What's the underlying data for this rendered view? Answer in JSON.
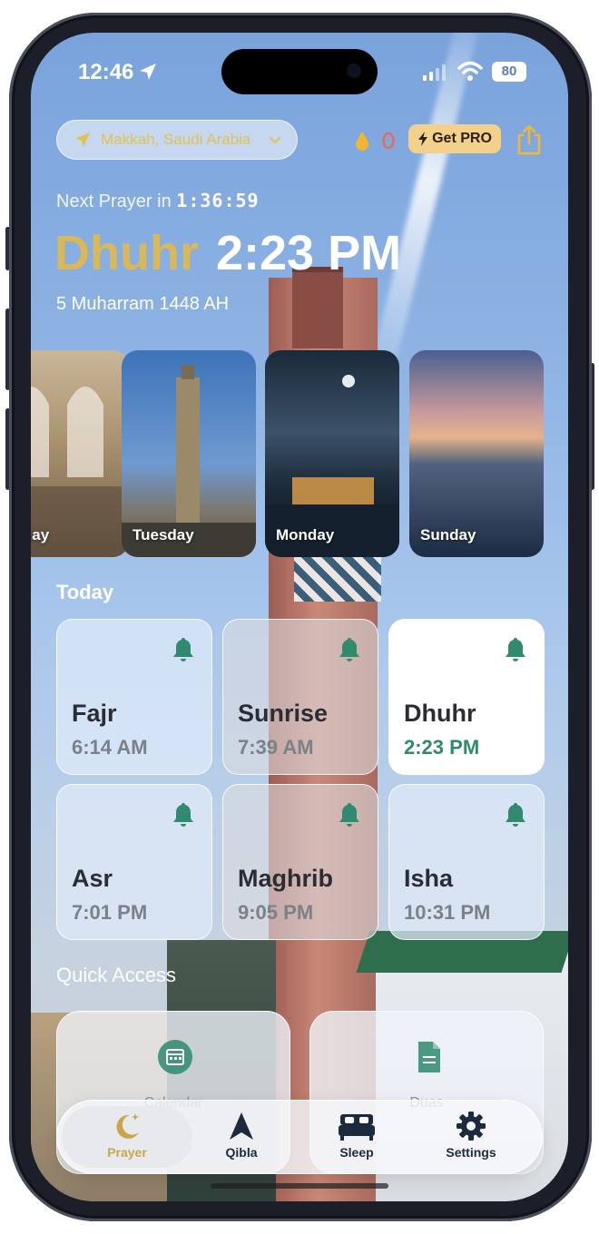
{
  "status_bar": {
    "time": "12:46",
    "battery": "80"
  },
  "header": {
    "location": "Makkah, Saudi Arabia",
    "streak_count": "0",
    "pro_label": "Get PRO"
  },
  "next_prayer": {
    "label": "Next Prayer in",
    "countdown": "1:36:59",
    "name": "Dhuhr",
    "time": "2:23 PM",
    "hijri_date": "5 Muharram 1448 AH"
  },
  "wallpapers": [
    {
      "label": "esday"
    },
    {
      "label": "Tuesday"
    },
    {
      "label": "Monday"
    },
    {
      "label": "Sunday"
    }
  ],
  "today": {
    "title": "Today",
    "prayers": [
      {
        "name": "Fajr",
        "time": "6:14 AM"
      },
      {
        "name": "Sunrise",
        "time": "7:39 AM"
      },
      {
        "name": "Dhuhr",
        "time": "2:23 PM"
      },
      {
        "name": "Asr",
        "time": "7:01 PM"
      },
      {
        "name": "Maghrib",
        "time": "9:05 PM"
      },
      {
        "name": "Isha",
        "time": "10:31 PM"
      }
    ]
  },
  "quick_access": {
    "title": "Quick Access",
    "items": [
      {
        "label": "Calendar"
      },
      {
        "label": "Duas"
      }
    ]
  },
  "tabs": [
    {
      "label": "Prayer",
      "icon": "moon-icon"
    },
    {
      "label": "Qibla",
      "icon": "compass-arrow-icon"
    },
    {
      "label": "Sleep",
      "icon": "bed-icon"
    },
    {
      "label": "Settings",
      "icon": "gear-icon"
    }
  ],
  "colors": {
    "accent_gold": "#d9b85a",
    "accent_green": "#2f8a6e",
    "pro_badge": "#f4d18a"
  }
}
